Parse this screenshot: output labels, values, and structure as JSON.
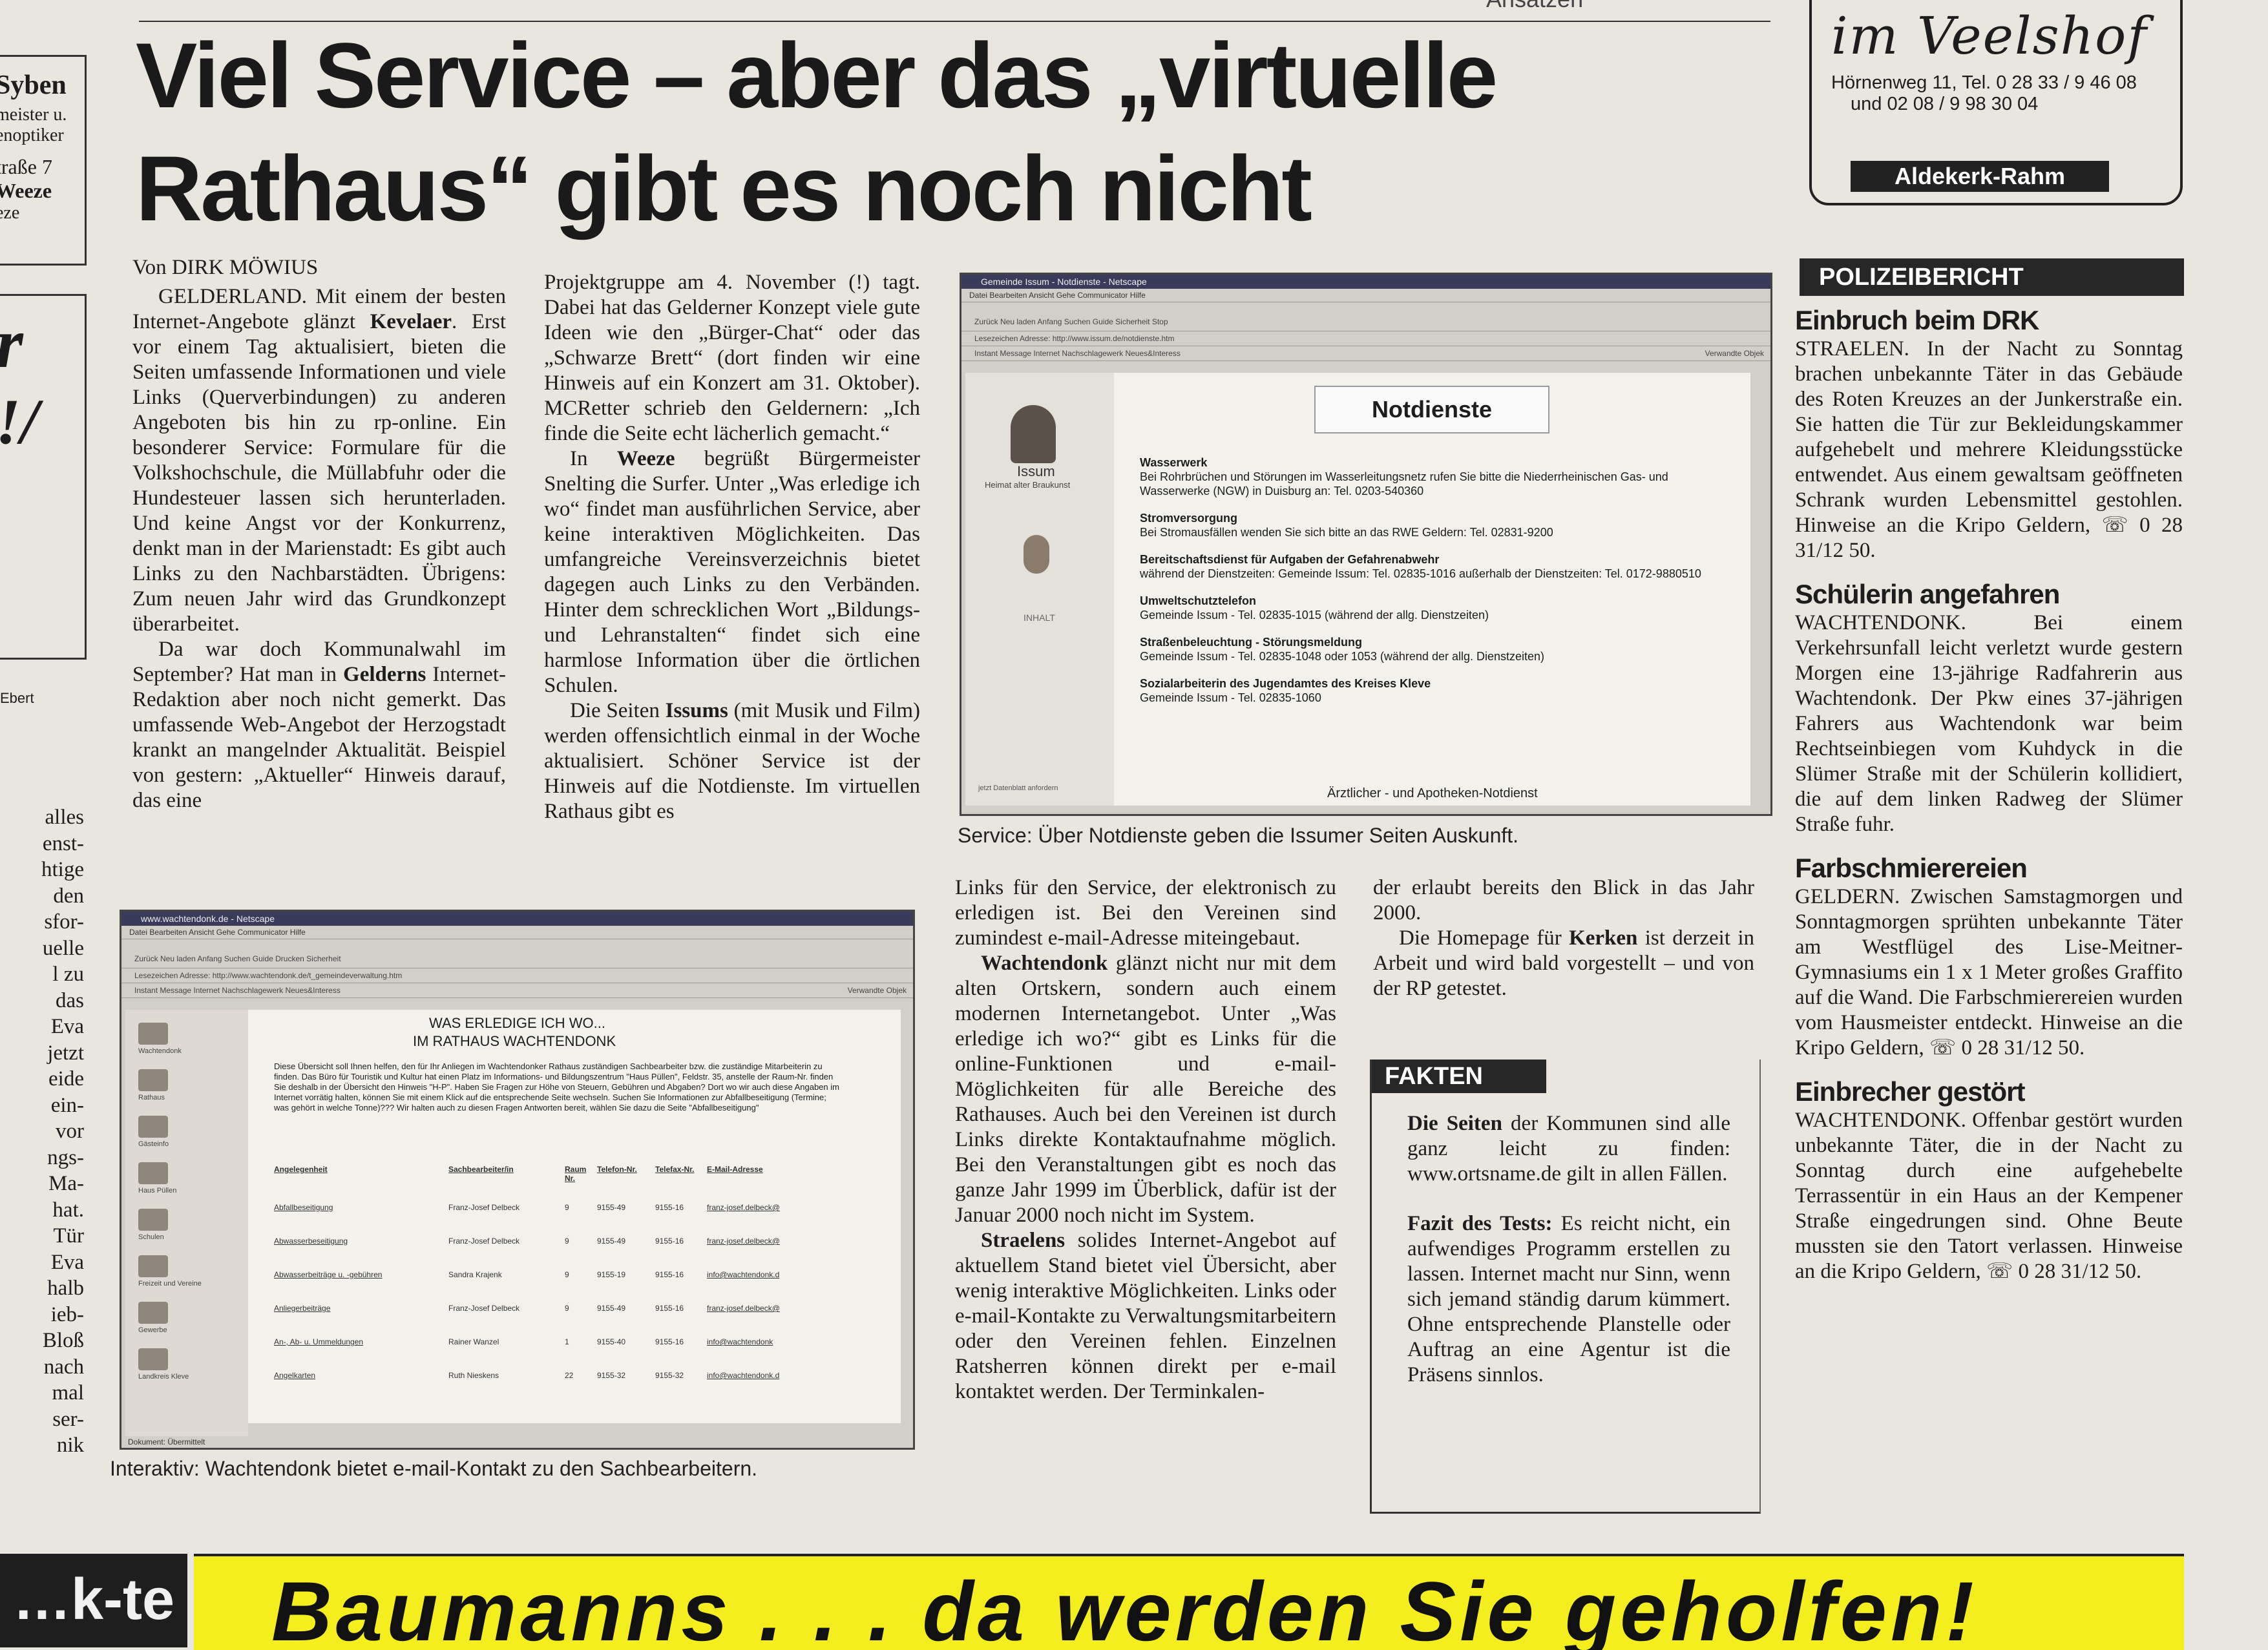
{
  "top_cut": "Ansätzen",
  "left_ad": {
    "name": "Syben",
    "line1": "meister u.",
    "line2": "enoptiker",
    "line3": "traße 7",
    "line4": "Weeze",
    "line5": "eze"
  },
  "left_ad2": {
    "mark1": "r",
    "mark2": "!/"
  },
  "left_strip": {
    "label": "Ebert",
    "words": [
      "alles",
      "enst-",
      "htige",
      "den",
      "sfor-",
      "uelle",
      "l zu",
      "das",
      "Eva",
      "jetzt",
      "eide",
      "ein-",
      "vor",
      "ngs-",
      "Ma-",
      "hat.",
      "Tür",
      "Eva",
      "halb",
      "ieb-",
      "Bloß",
      "nach",
      "mal",
      "ser-",
      "nik"
    ]
  },
  "headline": {
    "line1": "Viel Service – aber das „virtuelle",
    "line2": "Rathaus“ gibt es noch nicht"
  },
  "byline": "Von DIRK MÖWIUS",
  "article": {
    "col1": {
      "p1_start": "GELDERLAND.",
      "p1a": " Mit einem der besten Internet-Angebote glänzt ",
      "p1_bold": "Kevelaer",
      "p1b": ". Erst vor einem Tag aktualisiert, bieten die Seiten umfassende Informationen und viele Links (Querverbindungen) zu anderen Angeboten bis hin zu rp-online. Ein besonderer Service: Formulare für die Volkshochschule, die Müllabfuhr oder die Hundesteuer lassen sich herunterladen. Und keine Angst vor der Konkurrenz, denkt man in der Marienstadt: Es gibt auch Links zu den Nachbarstädten. Übrigens: Zum neuen Jahr wird das Grundkonzept überarbeitet.",
      "p2a": "Da war doch Kommunalwahl im September? Hat man in ",
      "p2_bold": "Gelderns",
      "p2b": " Internet-Redaktion aber noch nicht gemerkt. Das umfassende Web-Angebot der Herzogstadt krankt an mangelnder Aktualität. Beispiel von gestern: „Aktueller“ Hinweis darauf, das eine"
    },
    "col2": {
      "p1": "Projektgruppe am 4. November (!) tagt. Dabei hat das Gelderner Konzept viele gute Ideen wie den „Bürger-Chat“ oder das „Schwarze Brett“ (dort finden wir eine Hinweis auf ein Konzert am 31. Oktober). MCRetter schrieb den Geldernern: „Ich finde die Seite echt lächerlich gemacht.“",
      "p2a": "In ",
      "p2_bold": "Weeze",
      "p2b": " begrüßt Bürgermeister Snelting die Surfer. Unter „Was erledige ich wo“ findet man ausführlichen Service, aber keine interaktiven Möglichkeiten. Das umfangreiche Vereinsverzeichnis bietet dagegen auch Links zu den Verbänden. Hinter dem schrecklichen Wort „Bildungs- und Lehranstalten“ findet sich eine harmlose Information über die örtlichen Schulen.",
      "p3a": "Die Seiten ",
      "p3_bold": "Issums",
      "p3b": " (mit Musik und Film) werden offensichtlich einmal in der Woche aktualisiert. Schöner Service ist der Hinweis auf die Notdienste. Im virtuellen Rathaus gibt es"
    },
    "col3": {
      "p1": "Links für den Service, der elektronisch zu erledigen ist. Bei den Vereinen sind zumindest e-mail-Adresse miteingebaut.",
      "p2_bold": "Wachtendonk",
      "p2b": " glänzt nicht nur mit dem alten Ortskern, sondern auch einem modernen Internetangebot. Unter „Was erledige ich wo?“ gibt es Links für die online-Funktionen und e-mail-Möglichkeiten für alle Bereiche des Rathauses. Auch bei den Vereinen ist durch Links direkte Kontaktaufnahme möglich. Bei den Veranstaltungen gibt es noch das ganze Jahr 1999 im Überblick, dafür ist der Januar 2000 noch nicht im System.",
      "p3_bold": "Straelens",
      "p3b": " solides Internet-Angebot auf aktuellem Stand bietet viel Übersicht, aber wenig interaktive Möglichkeiten. Links oder e-mail-Kontakte zu Verwaltungsmitarbeitern oder den Vereinen fehlen. Einzelnen Ratsherren können direkt per e-mail kontaktet werden. Der Terminkalen-"
    },
    "col4": {
      "p1": "der erlaubt bereits den Blick in das Jahr 2000.",
      "p2a": "Die Homepage für ",
      "p2_bold": "Kerken",
      "p2b": " ist derzeit in Arbeit und wird bald vorgestellt – und von der RP getestet."
    }
  },
  "screenshot_issum": {
    "titlebar": "Gemeinde Issum - Notdienste - Netscape",
    "menu": "Datei  Bearbeiten  Ansicht  Gehe  Communicator  Hilfe",
    "tools": "Zurück    Neu laden    Anfang    Suchen    Guide    Sicherheit    Stop",
    "address": "Lesezeichen  Adresse: http://www.issum.de/notdienste.htm",
    "links": "Instant Message   Internet   Nachschlagewerk   Neues&Interess",
    "right_link": "Verwandte Objek",
    "logo_text": "Issum",
    "logo_sub": "Heimat alter Braukunst",
    "side_label": "INHALT",
    "side_bottom": "jetzt Datenblatt anfordern",
    "page_title": "Notdienste",
    "entries": [
      {
        "title": "Wasserwerk",
        "text": "Bei Rohrbrüchen und Störungen im Wasserleitungsnetz rufen Sie bitte die Niederrheinischen Gas- und Wasserwerke (NGW) in Duisburg an: Tel. 0203-540360"
      },
      {
        "title": "Stromversorgung",
        "text": "Bei Stromausfällen wenden Sie sich bitte an das RWE Geldern: Tel. 02831-9200"
      },
      {
        "title": "Bereitschaftsdienst für Aufgaben der Gefahrenabwehr",
        "text": "während der Dienstzeiten: Gemeinde Issum: Tel. 02835-1016 außerhalb der Dienstzeiten: Tel. 0172-9880510"
      },
      {
        "title": "Umweltschutztelefon",
        "text": "Gemeinde Issum - Tel. 02835-1015 (während der allg. Dienstzeiten)"
      },
      {
        "title": "Straßenbeleuchtung - Störungsmeldung",
        "text": "Gemeinde Issum - Tel. 02835-1048 oder 1053 (während der allg. Dienstzeiten)"
      },
      {
        "title": "Sozialarbeiterin des Jugendamtes des Kreises Kleve",
        "text": "Gemeinde Issum - Tel. 02835-1060"
      }
    ],
    "footer": "Ärztlicher - und Apotheken-Notdienst"
  },
  "caption_issum": "Service: Über Notdienste geben die Issumer Seiten Auskunft.",
  "screenshot_wachtendonk": {
    "titlebar": "www.wachtendonk.de - Netscape",
    "menu": "Datei  Bearbeiten  Ansicht  Gehe  Communicator  Hilfe",
    "tools": "Zurück    Neu laden    Anfang    Suchen    Guide    Drucken    Sicherheit",
    "address": "Lesezeichen  Adresse: http://www.wachtendonk.de/t_gemeindeverwaltung.htm",
    "links": "Instant Message   Internet   Nachschlagewerk   Neues&Interess",
    "right_link": "Verwandte Objek",
    "page_title1": "WAS ERLEDIGE ICH WO...",
    "page_title2": "IM RATHAUS WACHTENDONK",
    "intro": "Diese Übersicht soll Ihnen helfen, den für Ihr Anliegen im Wachtendonker Rathaus zuständigen Sachbearbeiter bzw. die zuständige Mitarbeiterin zu finden. Das Büro für Touristik und Kultur hat einen Platz im Informations- und Bildungszentrum \"Haus Püllen\", Feldstr. 35, anstelle der Raum-Nr. finden Sie deshalb in der Übersicht den Hinweis \"H-P\". Haben Sie Fragen zur Höhe von Steuern, Gebühren und Abgaben? Dort wo wir auch diese Angaben im Internet vorrätig halten, können Sie mit einem Klick auf die entsprechende Seite wechseln. Suchen Sie Informationen zur Abfallbeseitigung (Termine; was gehört in welche Tonne)??? Wir halten auch zu diesen Fragen Antworten bereit, wählen Sie dazu die Seite \"Abfallbeseitigung\"",
    "headers": [
      "Angelegenheit",
      "Sachbearbeiter/in",
      "Raum Nr.",
      "Telefon-Nr.",
      "Telefax-Nr.",
      "E-Mail-Adresse"
    ],
    "rows": [
      [
        "Abfallbeseitigung",
        "Franz-Josef Delbeck",
        "9",
        "9155-49",
        "9155-16",
        "franz-josef.delbeck@"
      ],
      [
        "Abwasserbeseitigung",
        "Franz-Josef Delbeck",
        "9",
        "9155-49",
        "9155-16",
        "franz-josef.delbeck@"
      ],
      [
        "Abwasserbeiträge u. -gebühren",
        "Sandra Krajenk",
        "9",
        "9155-19",
        "9155-16",
        "info@wachtendonk.d"
      ],
      [
        "Anliegerbeiträge",
        "Franz-Josef Delbeck",
        "9",
        "9155-49",
        "9155-16",
        "franz-josef.delbeck@"
      ],
      [
        "An-, Ab- u. Ummeldungen",
        "Rainer Wanzel",
        "1",
        "9155-40",
        "9155-16",
        "info@wachtendonk"
      ],
      [
        "Angelkarten",
        "Ruth Nieskens",
        "22",
        "9155-32",
        "9155-32",
        "info@wachtendonk.d"
      ]
    ],
    "side_items": [
      "Wachtendonk",
      "Rathaus",
      "Gästeinfo",
      "Haus Püllen",
      "Schulen",
      "Freizeit und Vereine",
      "Gewerbe",
      "Landkreis Kleve"
    ],
    "status": "Dokument: Übermittelt"
  },
  "caption_wachtendonk": "Interaktiv: Wachtendonk bietet e-mail-Kontakt zu den Sachbearbeitern.",
  "fakten": {
    "head": "FAKTEN",
    "p1_bold": "Die Seiten",
    "p1": " der Kommunen sind alle ganz leicht zu finden: www.ortsname.de gilt in allen Fällen.",
    "p2_bold": "Fazit des Tests:",
    "p2": " Es reicht nicht, ein aufwendiges Programm erstellen zu lassen. Internet macht nur Sinn, wenn sich jemand ständig darum kümmert. Ohne entsprechende Planstelle oder Auftrag an eine Agentur ist die Präsens sinnlos."
  },
  "ad_right": {
    "script": "im Veelshof",
    "addr1": "Hörnenweg 11, Tel. 0 28 33 / 9 46 08",
    "addr2": "und 02 08 / 9 98 30 04",
    "bar": "Aldekerk-Rahm"
  },
  "police": {
    "head": "POLIZEIBERICHT",
    "items": [
      {
        "title": "Einbruch beim DRK",
        "place": "STRAELEN.",
        "text": " In der Nacht zu Sonntag brachen unbekannte Täter in das Gebäude des Roten Kreuzes an der Junkerstraße ein. Sie hatten die Tür zur Bekleidungskammer aufgehebelt und mehrere Kleidungsstücke entwendet. Aus einem gewaltsam geöffneten Schrank wurden Lebensmittel gestohlen. Hinweise an die Kripo Geldern, ☏ 0 28 31/12 50."
      },
      {
        "title": "Schülerin angefahren",
        "place": "WACHTENDONK.",
        "text": " Bei einem Verkehrsunfall leicht verletzt wurde gestern Morgen eine 13-jährige Radfahrerin aus Wachtendonk. Der Pkw eines 37-jährigen Fahrers aus Wachtendonk war beim Rechtseinbiegen vom Kuhdyck in die Slümer Straße mit der Schülerin kollidiert, die auf dem linken Radweg der Slümer Straße fuhr."
      },
      {
        "title": "Farbschmierereien",
        "place": "GELDERN.",
        "text": " Zwischen Samstagmorgen und Sonntagmorgen sprühten unbekannte Täter am Westflügel des Lise-Meitner-Gymnasiums ein 1 x 1 Meter großes Graffito auf die Wand. Die Farbschmierereien wurden vom Hausmeister entdeckt. Hinweise an die Kripo Geldern, ☏ 0 28 31/12 50."
      },
      {
        "title": "Einbrecher gestört",
        "place": "WACHTENDONK.",
        "text": " Offenbar gestört wurden unbekannte Täter, die in der Nacht zu Sonntag durch eine aufgehebelte Terrassentür in ein Haus an der Kempener Straße eingedrungen sind. Ohne Beute mussten sie den Tatort verlassen. Hinweise an die Kripo Geldern, ☏ 0 28 31/12 50."
      }
    ]
  },
  "bottom_banner": {
    "left": "…k-te",
    "text": "Baumanns . . . da werden Sie geholfen!"
  }
}
